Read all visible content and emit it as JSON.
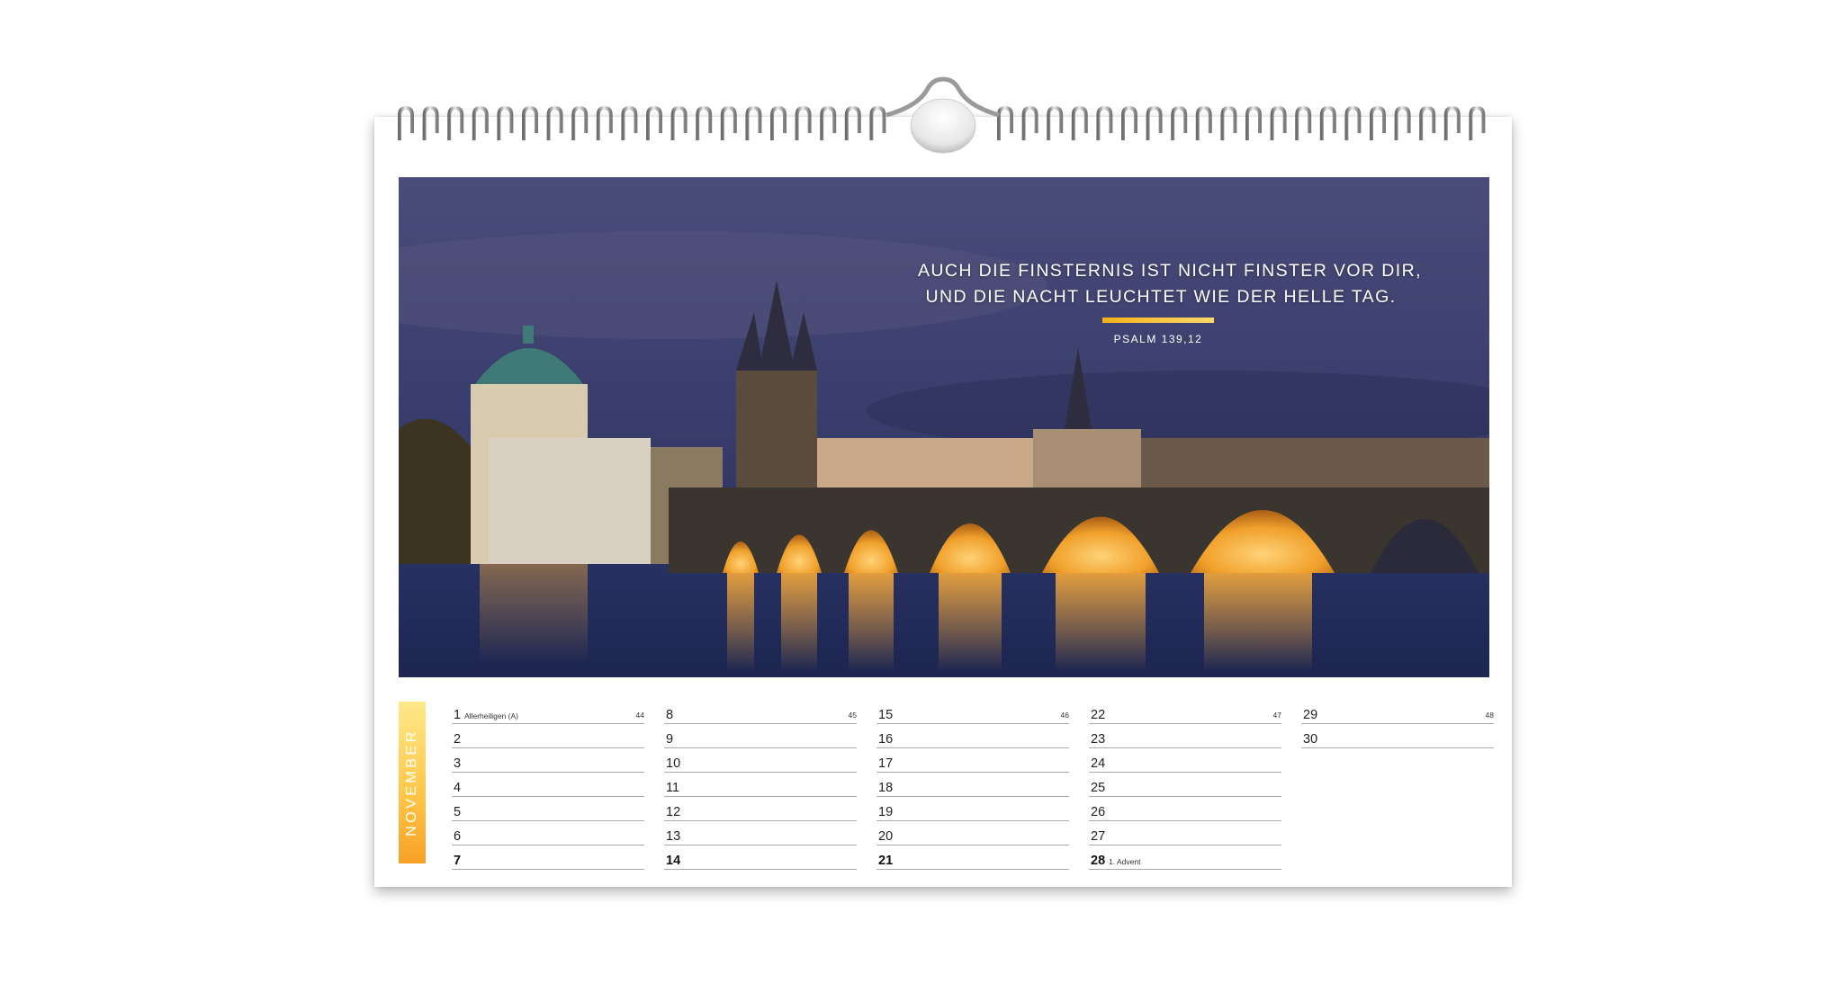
{
  "quote": {
    "line1": "AUCH DIE FINSTERNIS IST NICHT FINSTER VOR DIR,",
    "line2": "UND DIE NACHT LEUCHTET WIE DER HELLE TAG.",
    "source": "PSALM 139,12"
  },
  "month": "NOVEMBER",
  "colors": {
    "accent": "#f7a126",
    "accent_light": "#ffe98a",
    "sky": "#3b3f6e",
    "lights": "#f5a623"
  },
  "columns": [
    {
      "days": [
        {
          "num": "1",
          "note": "Allerheiligen (A)",
          "week": "44"
        },
        {
          "num": "2"
        },
        {
          "num": "3"
        },
        {
          "num": "4"
        },
        {
          "num": "5"
        },
        {
          "num": "6"
        },
        {
          "num": "7",
          "bold": true
        }
      ]
    },
    {
      "days": [
        {
          "num": "8",
          "week": "45"
        },
        {
          "num": "9"
        },
        {
          "num": "10"
        },
        {
          "num": "11"
        },
        {
          "num": "12"
        },
        {
          "num": "13"
        },
        {
          "num": "14",
          "bold": true
        }
      ]
    },
    {
      "days": [
        {
          "num": "15",
          "week": "46"
        },
        {
          "num": "16"
        },
        {
          "num": "17"
        },
        {
          "num": "18"
        },
        {
          "num": "19"
        },
        {
          "num": "20"
        },
        {
          "num": "21",
          "bold": true
        }
      ]
    },
    {
      "days": [
        {
          "num": "22",
          "week": "47"
        },
        {
          "num": "23"
        },
        {
          "num": "24"
        },
        {
          "num": "25"
        },
        {
          "num": "26"
        },
        {
          "num": "27"
        },
        {
          "num": "28",
          "note": "1. Advent",
          "bold": true
        }
      ]
    },
    {
      "days": [
        {
          "num": "29",
          "week": "48"
        },
        {
          "num": "30"
        }
      ]
    }
  ]
}
